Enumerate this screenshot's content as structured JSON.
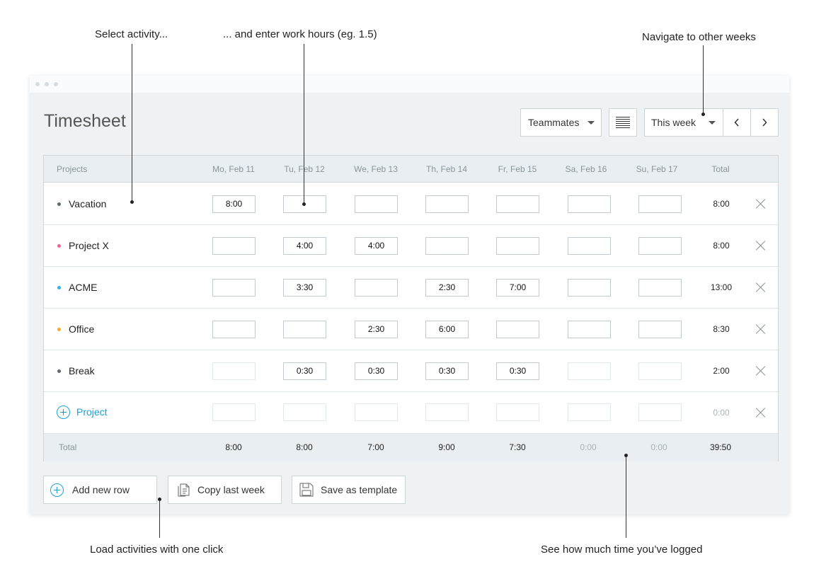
{
  "annotations": {
    "select_activity": "Select activity...",
    "enter_hours": "... and enter work hours (eg. 1.5)",
    "navigate": "Navigate to other weeks",
    "load_activities": "Load activities with one click",
    "see_logged": "See how much time you’ve logged"
  },
  "header": {
    "title": "Timesheet",
    "teammates_label": "Teammates",
    "week_label": "This week",
    "list_view_icon": "list-icon",
    "prev_icon": "chevron-left-icon",
    "next_icon": "chevron-right-icon"
  },
  "table": {
    "columns": [
      "Projects",
      "Mo, Feb 11",
      "Tu, Feb 12",
      "We, Feb 13",
      "Th, Feb 14",
      "Fr, Feb 15",
      "Sa, Feb 16",
      "Su, Feb 17",
      "Total"
    ],
    "rows": [
      {
        "name": "Vacation",
        "color": "#5d6b73",
        "hours": [
          "8:00",
          "",
          "",
          "",
          "",
          "",
          ""
        ],
        "total": "8:00"
      },
      {
        "name": "Project X",
        "color": "#f06292",
        "hours": [
          "",
          "4:00",
          "4:00",
          "",
          "",
          "",
          ""
        ],
        "total": "8:00"
      },
      {
        "name": "ACME",
        "color": "#29b6f6",
        "hours": [
          "",
          "3:30",
          "",
          "2:30",
          "7:00",
          "",
          ""
        ],
        "total": "13:00"
      },
      {
        "name": "Office",
        "color": "#ffa726",
        "hours": [
          "",
          "",
          "2:30",
          "6:00",
          "",
          "",
          ""
        ],
        "total": "8:30"
      },
      {
        "name": "Break",
        "color": "#5d6b73",
        "hours": [
          "",
          "0:30",
          "0:30",
          "0:30",
          "0:30",
          "",
          ""
        ],
        "total": "2:00"
      }
    ],
    "new_row": {
      "label": "Project",
      "total": "0:00"
    },
    "footer": {
      "label": "Total",
      "values": [
        "8:00",
        "8:00",
        "7:00",
        "9:00",
        "7:30",
        "0:00",
        "0:00"
      ],
      "grand_total": "39:50"
    }
  },
  "actions": {
    "add_row": "Add new row",
    "copy_week": "Copy last week",
    "save_template": "Save as template"
  },
  "colors": {
    "accent": "#1aa0d8",
    "background": "#eef2f4",
    "header_bg": "#e8eef1"
  }
}
